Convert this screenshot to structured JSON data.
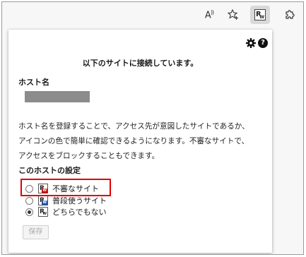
{
  "toolbar": {
    "read_aloud_label": "A",
    "read_aloud_super": "))",
    "extension_logo": "R",
    "extension_logo_sub": "W"
  },
  "popup": {
    "help_label": "?",
    "title": "以下のサイトに接続しています。",
    "host_name_label": "ホスト名",
    "description_lines": [
      "ホスト名を登録することで、アクセス先が意図したサイトであるか、",
      "アイコンの色で簡単に確認できるようになります。不審なサイトで、",
      "アクセスをブロックすることもできます。"
    ],
    "host_settings_label": "このホストの設定",
    "options": [
      {
        "label": "不審なサイト",
        "icon": "suspicious-site-icon",
        "icon_letter": "R",
        "icon_sub": "W",
        "icon_color": "#d40000",
        "checked": false
      },
      {
        "label": "普段使うサイト",
        "icon": "usual-site-icon",
        "icon_letter": "R",
        "icon_sub": "W",
        "icon_color": "#1f4fa8",
        "checked": false
      },
      {
        "label": "どちらでもない",
        "icon": "neutral-site-icon",
        "icon_letter": "R",
        "icon_sub": "W",
        "icon_color": "#ffffff",
        "checked": true
      }
    ],
    "save_label": "保存"
  },
  "colors": {
    "highlight_border": "#e00000",
    "toolbar_background": "#f7f7f7"
  }
}
